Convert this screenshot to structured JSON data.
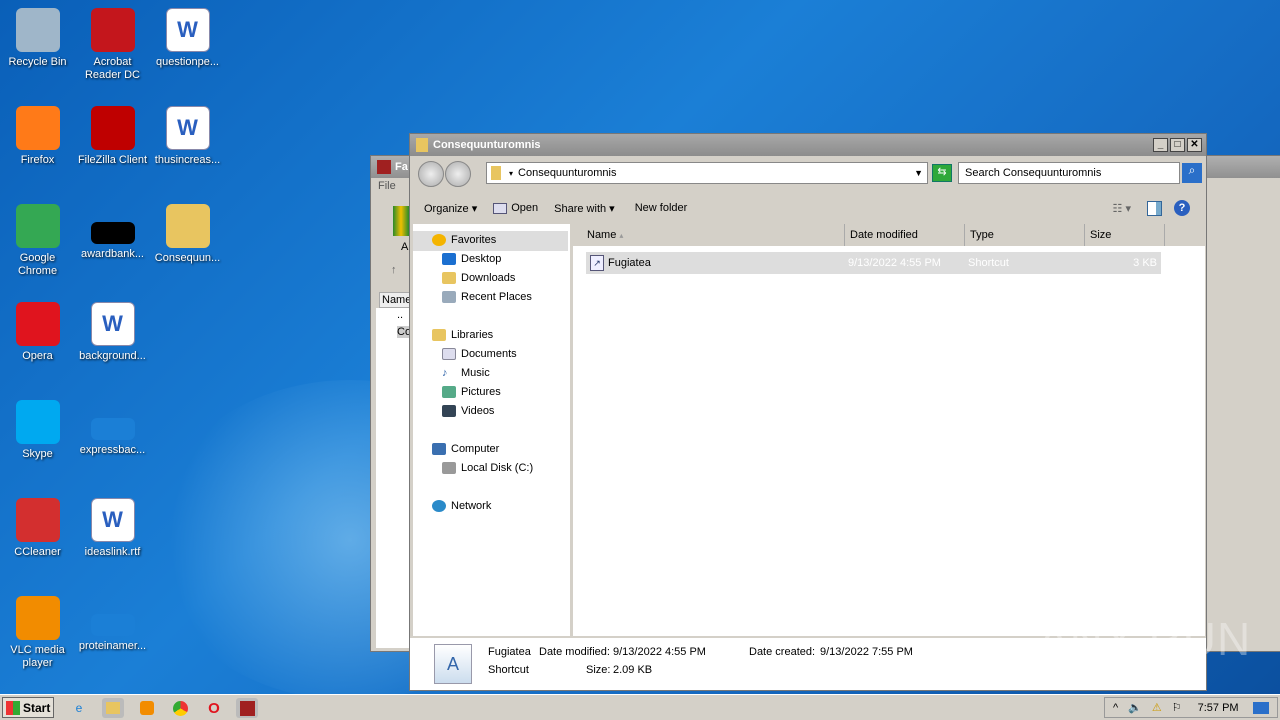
{
  "desktop": {
    "icons": [
      {
        "label": "Recycle Bin",
        "icon": "recycle-bin-icon",
        "color": "#9fb6c9"
      },
      {
        "label": "Acrobat Reader DC",
        "icon": "acrobat-icon",
        "color": "#c4161c"
      },
      {
        "label": "questionpe...",
        "icon": "word-doc-icon",
        "color": "#ffffff"
      },
      {
        "label": "Firefox",
        "icon": "firefox-icon",
        "color": "#ff7a18"
      },
      {
        "label": "FileZilla Client",
        "icon": "filezilla-icon",
        "color": "#bf0000"
      },
      {
        "label": "thusincreas...",
        "icon": "word-doc-icon",
        "color": "#ffffff"
      },
      {
        "label": "Google Chrome",
        "icon": "chrome-icon",
        "color": "#34a853"
      },
      {
        "label": "awardbank...",
        "icon": "blank-file-icon",
        "color": "#000000"
      },
      {
        "label": "Consequun...",
        "icon": "folder-icon",
        "color": "#e8c560"
      },
      {
        "label": "Opera",
        "icon": "opera-icon",
        "color": "#e0141e"
      },
      {
        "label": "background...",
        "icon": "word-doc-icon",
        "color": "#ffffff"
      },
      {
        "label": "Skype",
        "icon": "skype-icon",
        "color": "#00a9f0"
      },
      {
        "label": "expressbac...",
        "icon": "blank-file-icon",
        "color": "#1b7fd6"
      },
      {
        "label": "CCleaner",
        "icon": "ccleaner-icon",
        "color": "#d32f2f"
      },
      {
        "label": "ideaslink.rtf",
        "icon": "word-doc-icon",
        "color": "#ffffff"
      },
      {
        "label": "VLC media player",
        "icon": "vlc-icon",
        "color": "#f28c00"
      },
      {
        "label": "proteinamer...",
        "icon": "blank-file-icon",
        "color": "#1b7fd6"
      }
    ]
  },
  "bg_window": {
    "title": "Fa",
    "menu": "File",
    "toolbar_label": "A",
    "col": "Name",
    "rows": [
      "..",
      "Co"
    ]
  },
  "explorer": {
    "title": "Consequunturomnis",
    "address": "Consequunturomnis",
    "search_placeholder": "Search Consequunturomnis",
    "toolbar": {
      "organize": "Organize",
      "open": "Open",
      "share": "Share with",
      "new_folder": "New folder"
    },
    "nav": {
      "favorites": "Favorites",
      "desktop": "Desktop",
      "downloads": "Downloads",
      "recent": "Recent Places",
      "libraries": "Libraries",
      "documents": "Documents",
      "music": "Music",
      "pictures": "Pictures",
      "videos": "Videos",
      "computer": "Computer",
      "local_disk": "Local Disk (C:)",
      "network": "Network"
    },
    "columns": {
      "name": "Name",
      "date": "Date modified",
      "type": "Type",
      "size": "Size"
    },
    "files": [
      {
        "name": "Fugiatea",
        "date": "9/13/2022 4:55 PM",
        "type": "Shortcut",
        "size": "3 KB"
      }
    ],
    "details": {
      "name": "Fugiatea",
      "type": "Shortcut",
      "modified_label": "Date modified:",
      "modified": "9/13/2022 4:55 PM",
      "created_label": "Date created:",
      "created": "9/13/2022 7:55 PM",
      "size_label": "Size:",
      "size": "2.09 KB"
    }
  },
  "taskbar": {
    "start": "Start",
    "clock": "7:57 PM"
  },
  "watermark": "ANY RUN"
}
